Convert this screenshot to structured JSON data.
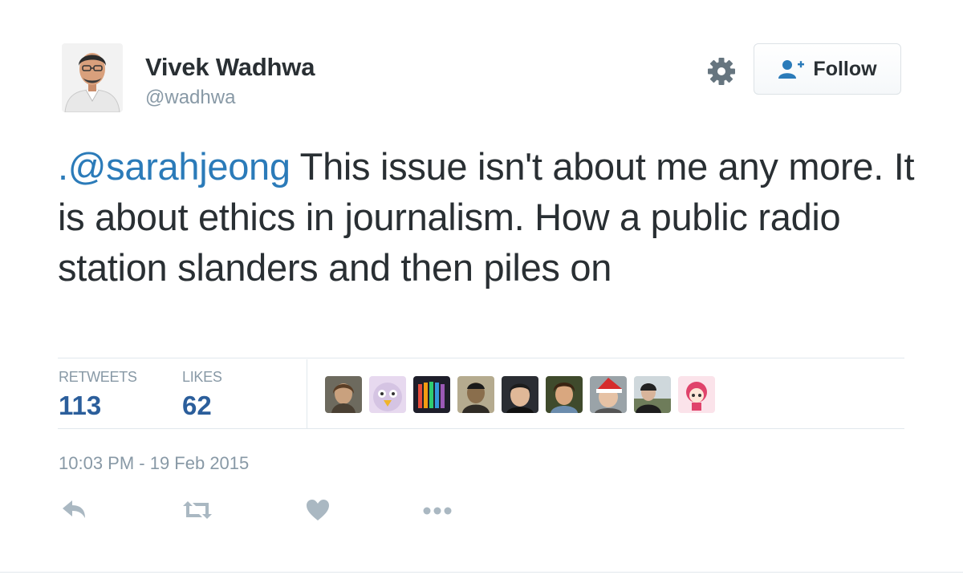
{
  "author": {
    "name": "Vivek Wadhwa",
    "handle": "@wadhwa"
  },
  "header": {
    "follow_label": "Follow"
  },
  "tweet": {
    "mention": ".@sarahjeong",
    "body": " This issue isn't about me any more. It is about ethics in journalism. How a public radio station slanders and then piles on"
  },
  "stats": {
    "retweets_label": "RETWEETS",
    "retweets_value": "113",
    "likes_label": "LIKES",
    "likes_value": "62"
  },
  "timestamp": "10:03 PM - 19 Feb 2015",
  "icons": {
    "settings": "gear-icon",
    "follow": "add-user-icon",
    "reply": "reply-icon",
    "retweet": "retweet-icon",
    "like": "heart-icon",
    "more": "more-icon"
  },
  "colors": {
    "text": "#292f33",
    "muted": "#8899a6",
    "link": "#2b7bb9",
    "stat_value": "#2b5e9b",
    "action_icon": "#aab8c2",
    "divider": "#e1e8ed"
  }
}
